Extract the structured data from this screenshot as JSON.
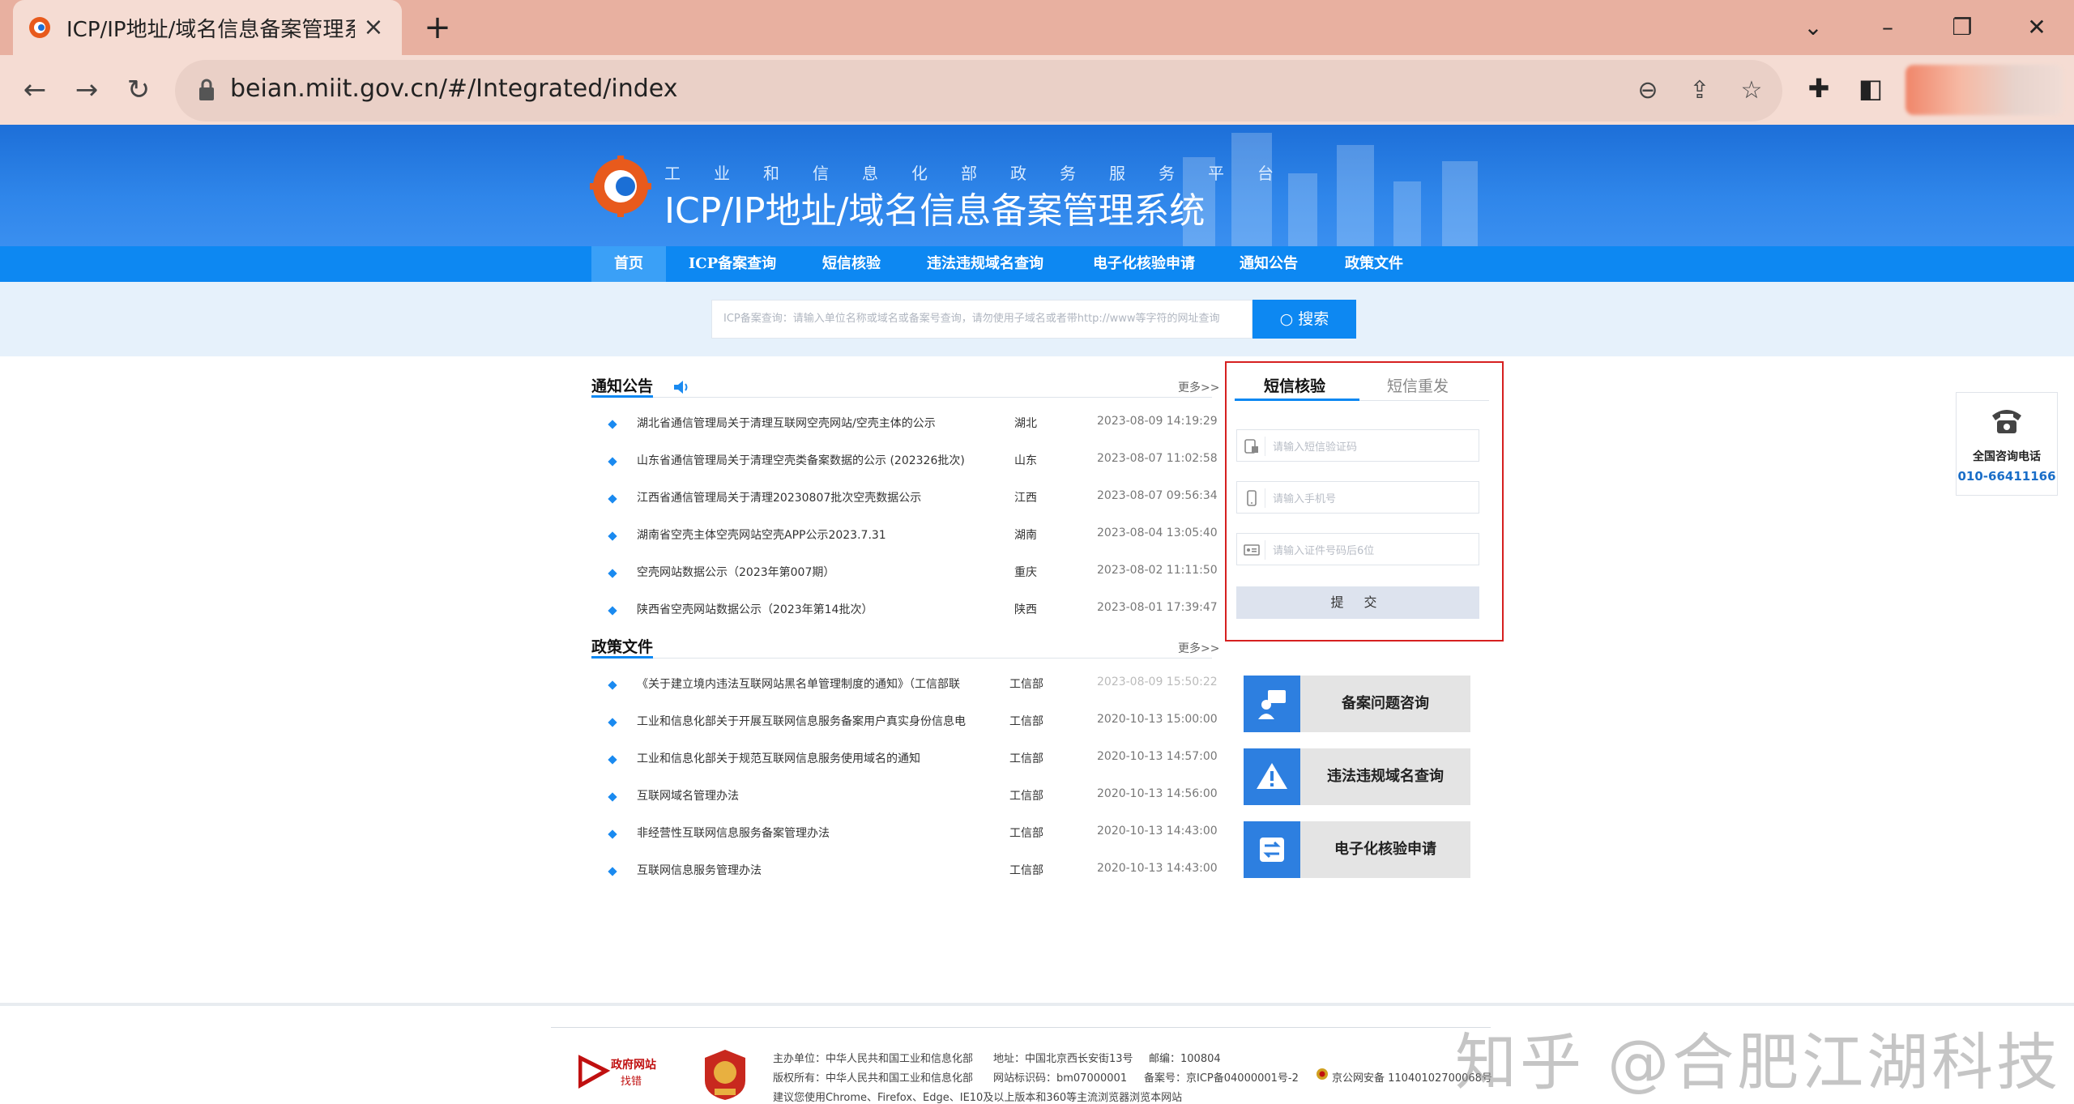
{
  "browser": {
    "tab_title": "ICP/IP地址/域名信息备案管理系统",
    "url": "beian.miit.gov.cn/#/Integrated/index"
  },
  "site": {
    "subtitle": "工业和信息化部政务服务平台",
    "title": "ICP/IP地址/域名信息备案管理系统",
    "nav": [
      "首页",
      "ICP备案查询",
      "短信核验",
      "违法违规域名查询",
      "电子化核验申请",
      "通知公告",
      "政策文件"
    ],
    "search": {
      "placeholder": "ICP备案查询：请输入单位名称或域名或备案号查询，请勿使用子域名或者带http://www等字符的网址查询",
      "button": "搜索"
    },
    "notices": {
      "title": "通知公告",
      "more": "更多>>",
      "items": [
        {
          "title": "湖北省通信管理局关于清理互联网空壳网站/空壳主体的公示",
          "region": "湖北",
          "date": "2023-08-09 14:19:29"
        },
        {
          "title": "山东省通信管理局关于清理空壳类备案数据的公示 (202326批次)",
          "region": "山东",
          "date": "2023-08-07 11:02:58"
        },
        {
          "title": "江西省通信管理局关于清理20230807批次空壳数据公示",
          "region": "江西",
          "date": "2023-08-07 09:56:34"
        },
        {
          "title": "湖南省空壳主体空壳网站空壳APP公示2023.7.31",
          "region": "湖南",
          "date": "2023-08-04 13:05:40"
        },
        {
          "title": "空壳网站数据公示（2023年第007期）",
          "region": "重庆",
          "date": "2023-08-02 11:11:50"
        },
        {
          "title": "陕西省空壳网站数据公示（2023年第14批次）",
          "region": "陕西",
          "date": "2023-08-01 17:39:47"
        }
      ]
    },
    "policies": {
      "title": "政策文件",
      "more": "更多>>",
      "items": [
        {
          "title": "《关于建立境内违法互联网站黑名单管理制度的通知》（工信部联",
          "region": "工信部",
          "date": "2023-08-09 15:50:22"
        },
        {
          "title": "工业和信息化部关于开展互联网信息服务备案用户真实身份信息电",
          "region": "工信部",
          "date": "2020-10-13 15:00:00"
        },
        {
          "title": "工业和信息化部关于规范互联网信息服务使用域名的通知",
          "region": "工信部",
          "date": "2020-10-13 14:57:00"
        },
        {
          "title": "互联网域名管理办法",
          "region": "工信部",
          "date": "2020-10-13 14:56:00"
        },
        {
          "title": "非经营性互联网信息服务备案管理办法",
          "region": "工信部",
          "date": "2020-10-13 14:43:00"
        },
        {
          "title": "互联网信息服务管理办法",
          "region": "工信部",
          "date": "2020-10-13 14:43:00"
        }
      ]
    },
    "sms": {
      "tab_verify": "短信核验",
      "tab_resend": "短信重发",
      "code_placeholder": "请输入短信验证码",
      "phone_placeholder": "请输入手机号",
      "id_placeholder": "请输入证件号码后6位",
      "submit": "提 交"
    },
    "quick_links": [
      "备案问题咨询",
      "违法违规域名查询",
      "电子化核验申请"
    ],
    "hotline": {
      "label": "全国咨询电话",
      "number": "010-66411166"
    },
    "footer": {
      "gov_badge_top": "政府网站",
      "gov_badge_bottom": "找错",
      "line1_host": "主办单位：中华人民共和国工业和信息化部",
      "line1_addr": "地址：中国北京西长安街13号",
      "line1_zip": "邮编：100804",
      "line2_copy": "版权所有：中华人民共和国工业和信息化部",
      "line2_code": "网站标识码：bm07000001",
      "line2_icp": "备案号：京ICP备04000001号-2",
      "line2_police": "京公网安备 11040102700068号",
      "line3": "建议您使用Chrome、Firefox、Edge、IE10及以上版本和360等主流浏览器浏览本网站"
    },
    "watermark": "知乎 @合肥江湖科技"
  }
}
